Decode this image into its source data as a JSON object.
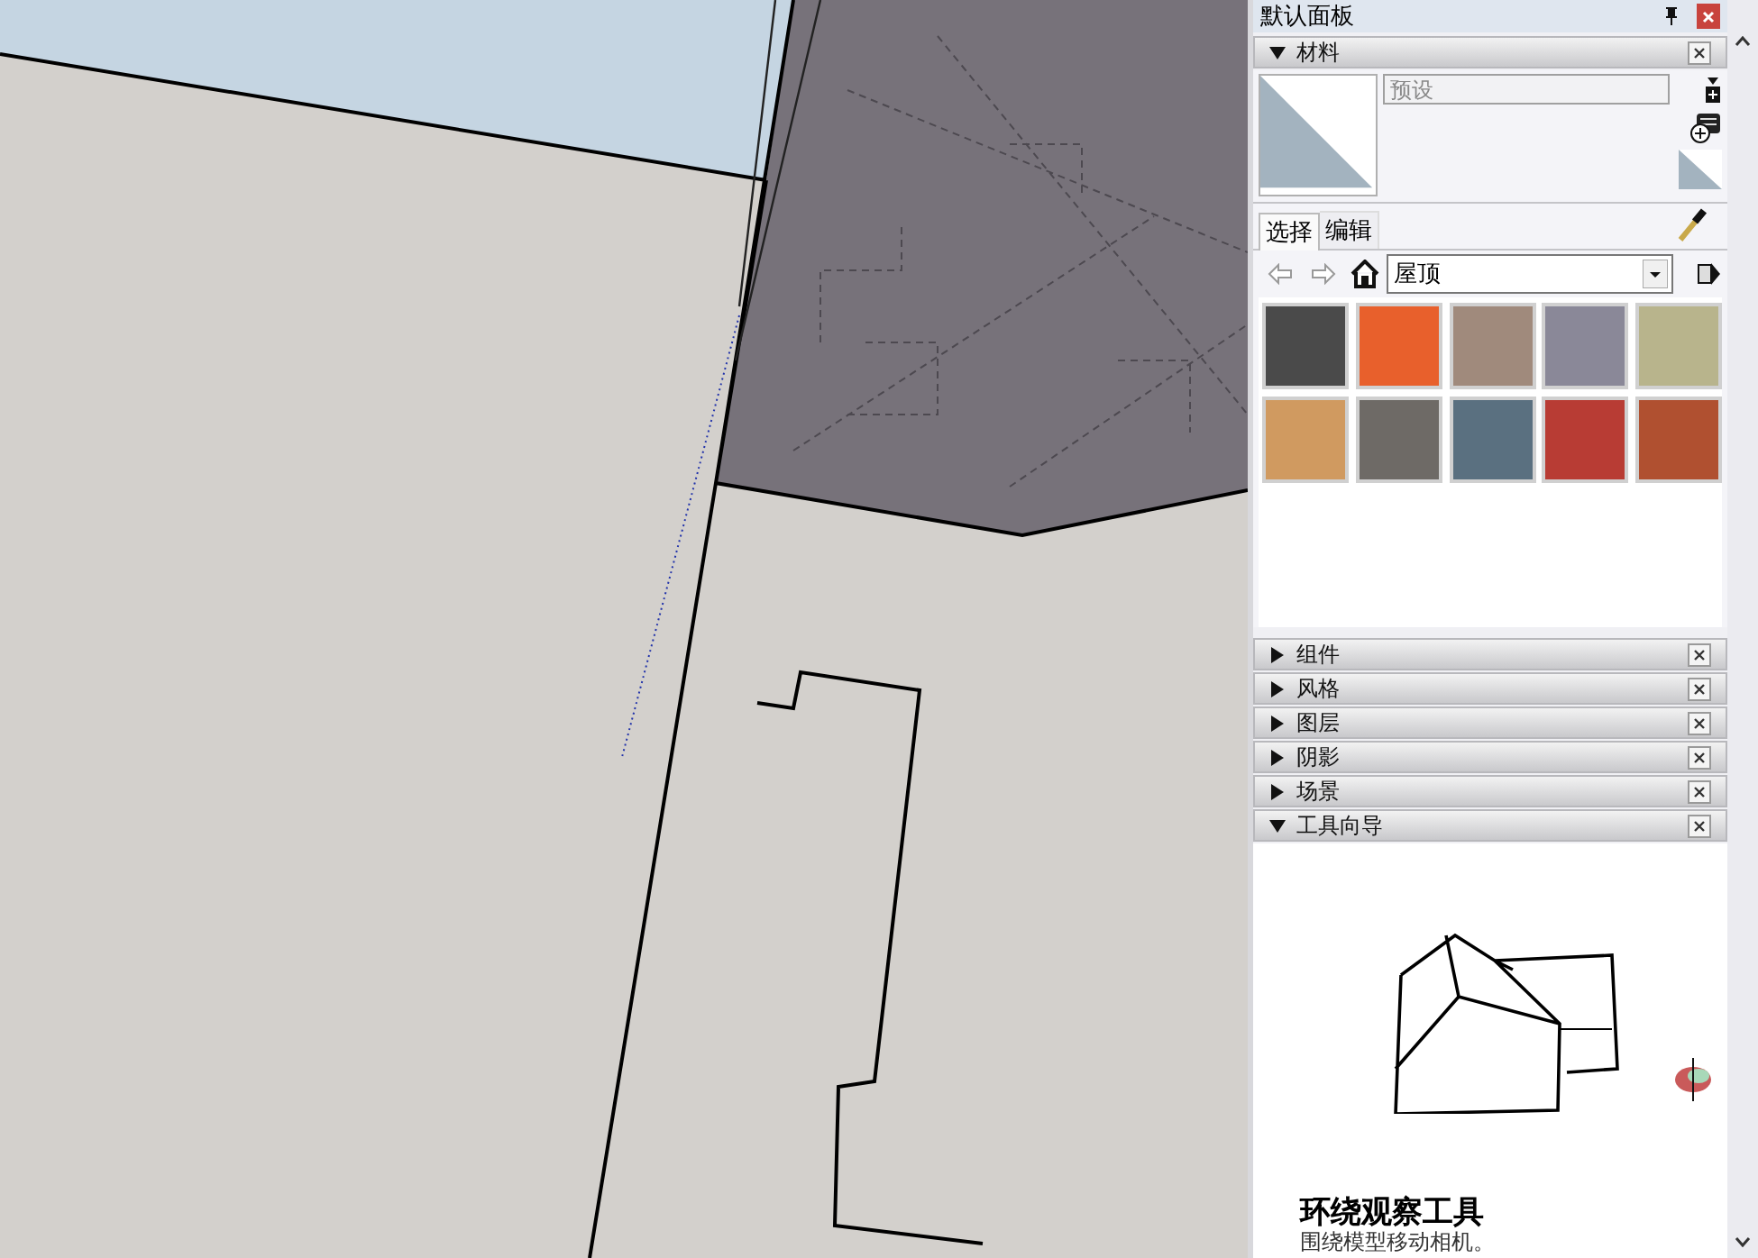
{
  "panel": {
    "title": "默认面板"
  },
  "materials": {
    "label": "材料",
    "expanded": true,
    "name_placeholder": "预设",
    "tabs": [
      {
        "label": "选择",
        "selected": true
      },
      {
        "label": "编辑",
        "selected": false
      }
    ],
    "library": "屋顶",
    "swatches": [
      {
        "color": "#4a4a4a"
      },
      {
        "color": "#e8602c"
      },
      {
        "color": "#a08a7c"
      },
      {
        "color": "#8a8898"
      },
      {
        "color": "#b8b48c"
      },
      {
        "color": "#d09a60"
      },
      {
        "color": "#6e6a66"
      },
      {
        "color": "#5a7080"
      },
      {
        "color": "#b83c34"
      },
      {
        "color": "#b05030"
      }
    ]
  },
  "sections": [
    {
      "label": "组件",
      "expanded": false
    },
    {
      "label": "风格",
      "expanded": false
    },
    {
      "label": "图层",
      "expanded": false
    },
    {
      "label": "阴影",
      "expanded": false
    },
    {
      "label": "场景",
      "expanded": false
    },
    {
      "label": "工具向导",
      "expanded": true
    }
  ],
  "tool_guide": {
    "title": "环绕观察工具",
    "description": "围绕模型移动相机。"
  }
}
